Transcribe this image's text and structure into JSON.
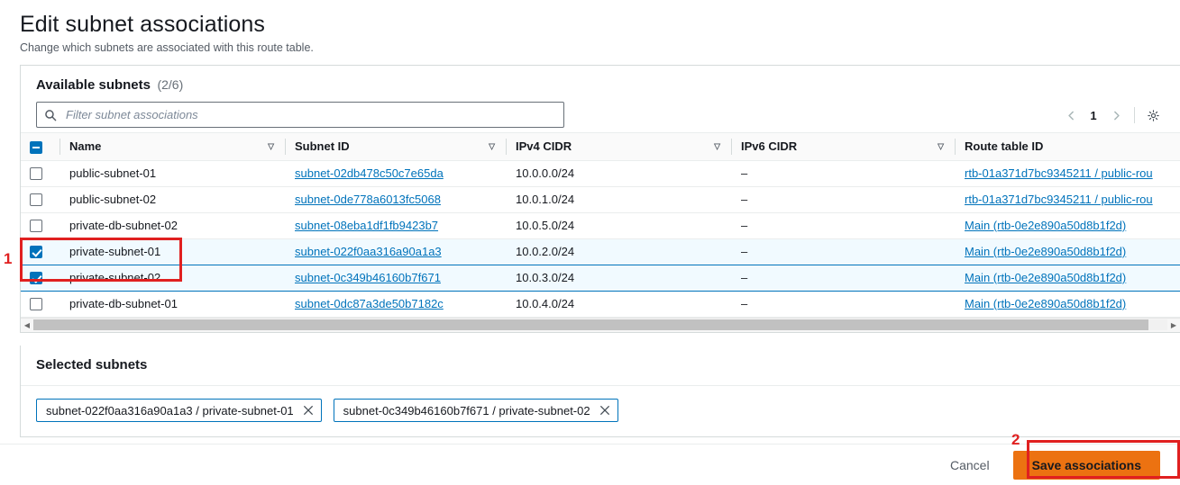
{
  "page": {
    "title": "Edit subnet associations",
    "subtitle": "Change which subnets are associated with this route table."
  },
  "available": {
    "title": "Available subnets",
    "count": "(2/6)",
    "search": {
      "placeholder": "Filter subnet associations",
      "value": "",
      "icon": "search-icon"
    },
    "pagination": {
      "prev_icon": "chevron-left-icon",
      "page": "1",
      "next_icon": "chevron-right-icon",
      "settings_icon": "gear-icon"
    },
    "columns": [
      {
        "label": "Name",
        "sort_icon": "sort-descending-icon"
      },
      {
        "label": "Subnet ID",
        "sort_icon": "sort-descending-icon"
      },
      {
        "label": "IPv4 CIDR",
        "sort_icon": "sort-descending-icon"
      },
      {
        "label": "IPv6 CIDR",
        "sort_icon": "sort-descending-icon"
      },
      {
        "label": "Route table ID",
        "sort_icon": ""
      }
    ],
    "select_all_state": "indeterminate",
    "rows": [
      {
        "selected": false,
        "name": "public-subnet-01",
        "subnet_id": "subnet-02db478c50c7e65da",
        "ipv4": "10.0.0.0/24",
        "ipv6": "–",
        "route_table": "rtb-01a371d7bc9345211 / public-rou"
      },
      {
        "selected": false,
        "name": "public-subnet-02",
        "subnet_id": "subnet-0de778a6013fc5068",
        "ipv4": "10.0.1.0/24",
        "ipv6": "–",
        "route_table": "rtb-01a371d7bc9345211 / public-rou"
      },
      {
        "selected": false,
        "name": "private-db-subnet-02",
        "subnet_id": "subnet-08eba1df1fb9423b7",
        "ipv4": "10.0.5.0/24",
        "ipv6": "–",
        "route_table": "Main (rtb-0e2e890a50d8b1f2d)"
      },
      {
        "selected": true,
        "name": "private-subnet-01",
        "subnet_id": "subnet-022f0aa316a90a1a3",
        "ipv4": "10.0.2.0/24",
        "ipv6": "–",
        "route_table": "Main (rtb-0e2e890a50d8b1f2d)"
      },
      {
        "selected": true,
        "name": "private-subnet-02",
        "subnet_id": "subnet-0c349b46160b7f671",
        "ipv4": "10.0.3.0/24",
        "ipv6": "–",
        "route_table": "Main (rtb-0e2e890a50d8b1f2d)"
      },
      {
        "selected": false,
        "name": "private-db-subnet-01",
        "subnet_id": "subnet-0dc87a3de50b7182c",
        "ipv4": "10.0.4.0/24",
        "ipv6": "–",
        "route_table": "Main (rtb-0e2e890a50d8b1f2d)"
      }
    ],
    "scrollbar": {
      "left_icon": "scroll-left-arrow-icon",
      "right_icon": "scroll-right-arrow-icon"
    }
  },
  "selected_subnets": {
    "title": "Selected subnets",
    "tokens": [
      {
        "label": "subnet-022f0aa316a90a1a3 / private-subnet-01",
        "remove_icon": "close-icon"
      },
      {
        "label": "subnet-0c349b46160b7f671 / private-subnet-02",
        "remove_icon": "close-icon"
      }
    ]
  },
  "footer": {
    "cancel_label": "Cancel",
    "save_label": "Save associations"
  },
  "annotations": [
    {
      "number": "1",
      "target": "selected-subnet-rows"
    },
    {
      "number": "2",
      "target": "save-associations-button"
    }
  ],
  "colors": {
    "accent_link": "#0073bb",
    "primary_button": "#ec7211",
    "annotation": "#e02020",
    "selected_row_bg": "#f1faff"
  }
}
